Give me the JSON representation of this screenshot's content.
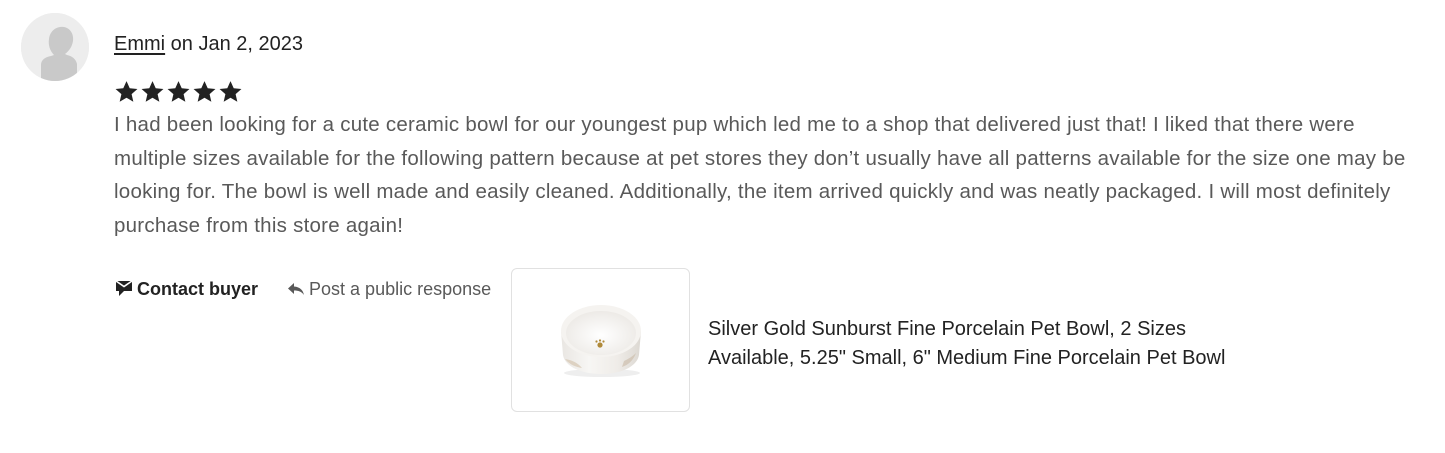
{
  "review": {
    "reviewer_name": "Emmi",
    "date_text": " on Jan 2, 2023",
    "rating": 5,
    "rating_max": 5,
    "text": "I had been looking for a cute ceramic bowl for our youngest pup which led me to a shop that delivered just that! I liked that there were multiple sizes available for the following pattern because at pet stores they don’t usually have all patterns available for the size one may be looking for. The bowl is well made and easily cleaned. Additionally, the item arrived quickly and was neatly packaged. I will most definitely purchase from this store again!"
  },
  "actions": {
    "contact_label": "Contact buyer",
    "respond_label": "Post a public response"
  },
  "product": {
    "title": "Silver Gold Sunburst Fine Porcelain Pet Bowl, 2 Sizes Available, 5.25\" Small, 6\" Medium Fine Porcelain Pet Bowl"
  },
  "icons": {
    "avatar": "default-user-silhouette-icon",
    "star": "star-icon",
    "contact": "message-envelope-icon",
    "respond": "reply-arrow-icon"
  },
  "colors": {
    "text_primary": "#222222",
    "text_secondary": "#595959",
    "star": "#222222",
    "border": "#e1e1e1"
  }
}
